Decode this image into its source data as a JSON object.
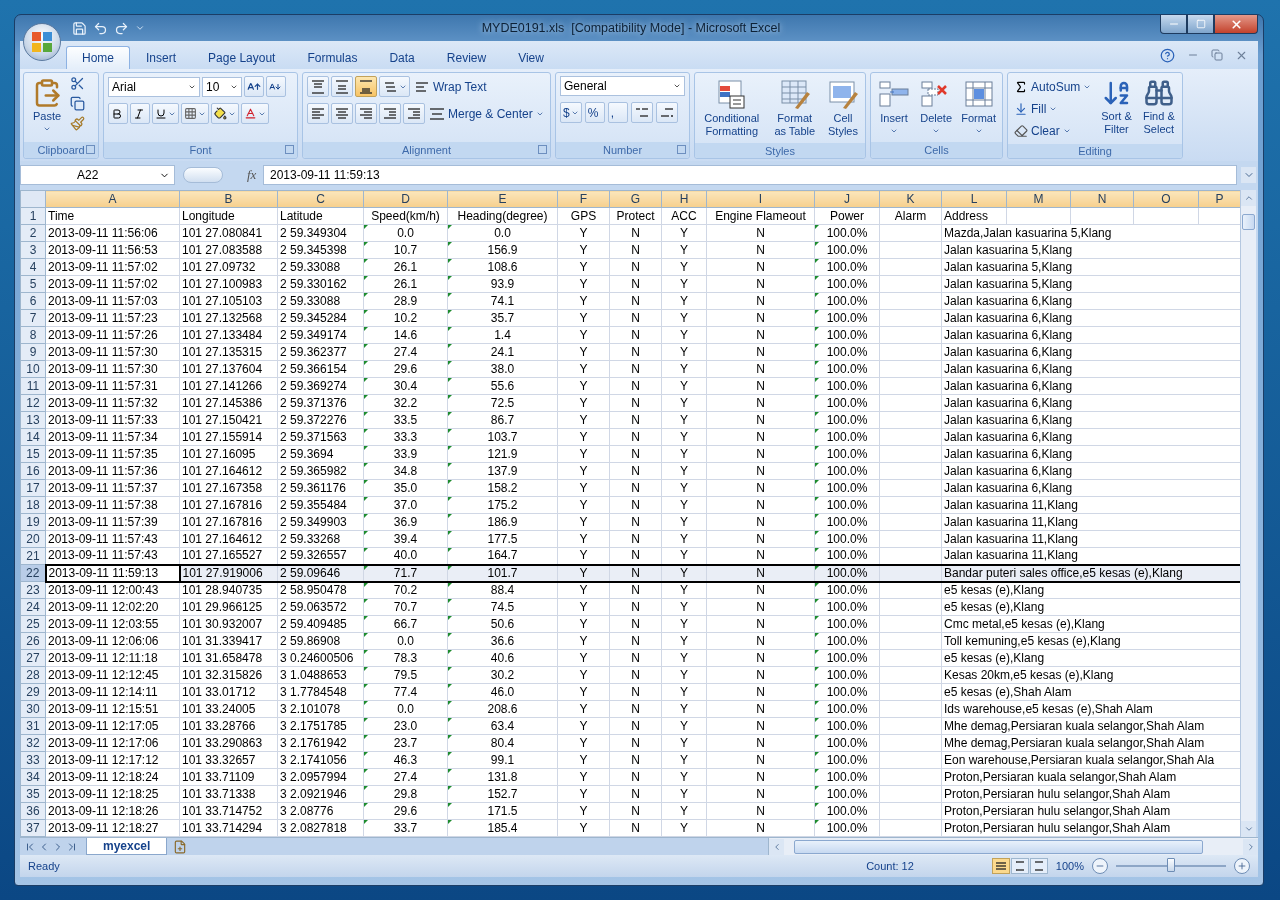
{
  "window": {
    "title": "MYDE0191.xls  [Compatibility Mode] - Microsoft Excel"
  },
  "tabs": [
    {
      "label": "Home",
      "selected": true
    },
    {
      "label": "Insert",
      "selected": false
    },
    {
      "label": "Page Layout",
      "selected": false
    },
    {
      "label": "Formulas",
      "selected": false
    },
    {
      "label": "Data",
      "selected": false
    },
    {
      "label": "Review",
      "selected": false
    },
    {
      "label": "View",
      "selected": false
    }
  ],
  "ribbon": {
    "clipboard": {
      "label": "Clipboard",
      "paste": "Paste"
    },
    "font": {
      "label": "Font",
      "font_name": "Arial",
      "font_size": "10"
    },
    "alignment": {
      "label": "Alignment",
      "vertical_align": [
        {
          "selected": false
        },
        {
          "selected": false
        },
        {
          "selected": true
        }
      ],
      "wrap_text": "Wrap Text",
      "merge_center": "Merge & Center"
    },
    "number": {
      "label": "Number",
      "format": "General",
      "currency": "$",
      "percent": "%",
      "comma": ","
    },
    "styles": {
      "label": "Styles",
      "buttons": [
        "Conditional Formatting",
        "Format as Table",
        "Cell Styles"
      ]
    },
    "cells": {
      "label": "Cells",
      "buttons": [
        "Insert",
        "Delete",
        "Format"
      ]
    },
    "editing": {
      "label": "Editing",
      "small": [
        "AutoSum",
        "Fill",
        "Clear"
      ],
      "large": [
        "Sort & Filter",
        "Find & Select"
      ]
    }
  },
  "formula_bar": {
    "name_box": "A22",
    "function_label": "fx",
    "value": "2013-09-11 11:59:13"
  },
  "columns": [
    {
      "letter": "A",
      "flagged": false
    },
    {
      "letter": "B",
      "flagged": false
    },
    {
      "letter": "C",
      "flagged": false
    },
    {
      "letter": "D",
      "flagged": true
    },
    {
      "letter": "E",
      "flagged": true
    },
    {
      "letter": "F",
      "flagged": false
    },
    {
      "letter": "G",
      "flagged": false
    },
    {
      "letter": "H",
      "flagged": false
    },
    {
      "letter": "I",
      "flagged": false
    },
    {
      "letter": "J",
      "flagged": true
    },
    {
      "letter": "K",
      "flagged": false
    },
    {
      "letter": "L",
      "flagged": false
    },
    {
      "letter": "M"
    },
    {
      "letter": "N"
    },
    {
      "letter": "O"
    },
    {
      "letter": "P"
    }
  ],
  "header_row": {
    "number": "1",
    "cells": [
      "Time",
      "Longitude",
      "Latitude",
      "Speed(km/h)",
      "Heading(degree)",
      "GPS",
      "Protect",
      "ACC",
      "Engine Flameout",
      "Power",
      "Alarm",
      "Address"
    ]
  },
  "rows": [
    {
      "number": "2",
      "selected": false,
      "cells": [
        "2013-09-11 11:56:06",
        "101 27.080841",
        "2 59.349304",
        "0.0",
        "0.0",
        "Y",
        "N",
        "Y",
        "N",
        "100.0%",
        "Mazda,Jalan kasuarina 5,Klang"
      ]
    },
    {
      "number": "3",
      "selected": false,
      "cells": [
        "2013-09-11 11:56:53",
        "101 27.083588",
        "2 59.345398",
        "10.7",
        "156.9",
        "Y",
        "N",
        "Y",
        "N",
        "100.0%",
        "Jalan kasuarina 5,Klang"
      ]
    },
    {
      "number": "4",
      "selected": false,
      "cells": [
        "2013-09-11 11:57:02",
        "101 27.09732",
        "2 59.33088",
        "26.1",
        "108.6",
        "Y",
        "N",
        "Y",
        "N",
        "100.0%",
        "Jalan kasuarina 5,Klang"
      ]
    },
    {
      "number": "5",
      "selected": false,
      "cells": [
        "2013-09-11 11:57:02",
        "101 27.100983",
        "2 59.330162",
        "26.1",
        "93.9",
        "Y",
        "N",
        "Y",
        "N",
        "100.0%",
        "Jalan kasuarina 5,Klang"
      ]
    },
    {
      "number": "6",
      "selected": false,
      "cells": [
        "2013-09-11 11:57:03",
        "101 27.105103",
        "2 59.33088",
        "28.9",
        "74.1",
        "Y",
        "N",
        "Y",
        "N",
        "100.0%",
        "Jalan kasuarina 6,Klang"
      ]
    },
    {
      "number": "7",
      "selected": false,
      "cells": [
        "2013-09-11 11:57:23",
        "101 27.132568",
        "2 59.345284",
        "10.2",
        "35.7",
        "Y",
        "N",
        "Y",
        "N",
        "100.0%",
        "Jalan kasuarina 6,Klang"
      ]
    },
    {
      "number": "8",
      "selected": false,
      "cells": [
        "2013-09-11 11:57:26",
        "101 27.133484",
        "2 59.349174",
        "14.6",
        "1.4",
        "Y",
        "N",
        "Y",
        "N",
        "100.0%",
        "Jalan kasuarina 6,Klang"
      ]
    },
    {
      "number": "9",
      "selected": false,
      "cells": [
        "2013-09-11 11:57:30",
        "101 27.135315",
        "2 59.362377",
        "27.4",
        "24.1",
        "Y",
        "N",
        "Y",
        "N",
        "100.0%",
        "Jalan kasuarina 6,Klang"
      ]
    },
    {
      "number": "10",
      "selected": false,
      "cells": [
        "2013-09-11 11:57:30",
        "101 27.137604",
        "2 59.366154",
        "29.6",
        "38.0",
        "Y",
        "N",
        "Y",
        "N",
        "100.0%",
        "Jalan kasuarina 6,Klang"
      ]
    },
    {
      "number": "11",
      "selected": false,
      "cells": [
        "2013-09-11 11:57:31",
        "101 27.141266",
        "2 59.369274",
        "30.4",
        "55.6",
        "Y",
        "N",
        "Y",
        "N",
        "100.0%",
        "Jalan kasuarina 6,Klang"
      ]
    },
    {
      "number": "12",
      "selected": false,
      "cells": [
        "2013-09-11 11:57:32",
        "101 27.145386",
        "2 59.371376",
        "32.2",
        "72.5",
        "Y",
        "N",
        "Y",
        "N",
        "100.0%",
        "Jalan kasuarina 6,Klang"
      ]
    },
    {
      "number": "13",
      "selected": false,
      "cells": [
        "2013-09-11 11:57:33",
        "101 27.150421",
        "2 59.372276",
        "33.5",
        "86.7",
        "Y",
        "N",
        "Y",
        "N",
        "100.0%",
        "Jalan kasuarina 6,Klang"
      ]
    },
    {
      "number": "14",
      "selected": false,
      "cells": [
        "2013-09-11 11:57:34",
        "101 27.155914",
        "2 59.371563",
        "33.3",
        "103.7",
        "Y",
        "N",
        "Y",
        "N",
        "100.0%",
        "Jalan kasuarina 6,Klang"
      ]
    },
    {
      "number": "15",
      "selected": false,
      "cells": [
        "2013-09-11 11:57:35",
        "101 27.16095",
        "2 59.3694",
        "33.9",
        "121.9",
        "Y",
        "N",
        "Y",
        "N",
        "100.0%",
        "Jalan kasuarina 6,Klang"
      ]
    },
    {
      "number": "16",
      "selected": false,
      "cells": [
        "2013-09-11 11:57:36",
        "101 27.164612",
        "2 59.365982",
        "34.8",
        "137.9",
        "Y",
        "N",
        "Y",
        "N",
        "100.0%",
        "Jalan kasuarina 6,Klang"
      ]
    },
    {
      "number": "17",
      "selected": false,
      "cells": [
        "2013-09-11 11:57:37",
        "101 27.167358",
        "2 59.361176",
        "35.0",
        "158.2",
        "Y",
        "N",
        "Y",
        "N",
        "100.0%",
        "Jalan kasuarina 6,Klang"
      ]
    },
    {
      "number": "18",
      "selected": false,
      "cells": [
        "2013-09-11 11:57:38",
        "101 27.167816",
        "2 59.355484",
        "37.0",
        "175.2",
        "Y",
        "N",
        "Y",
        "N",
        "100.0%",
        "Jalan kasuarina 11,Klang"
      ]
    },
    {
      "number": "19",
      "selected": false,
      "cells": [
        "2013-09-11 11:57:39",
        "101 27.167816",
        "2 59.349903",
        "36.9",
        "186.9",
        "Y",
        "N",
        "Y",
        "N",
        "100.0%",
        "Jalan kasuarina 11,Klang"
      ]
    },
    {
      "number": "20",
      "selected": false,
      "cells": [
        "2013-09-11 11:57:43",
        "101 27.164612",
        "2 59.33268",
        "39.4",
        "177.5",
        "Y",
        "N",
        "Y",
        "N",
        "100.0%",
        "Jalan kasuarina 11,Klang"
      ]
    },
    {
      "number": "21",
      "selected": false,
      "cells": [
        "2013-09-11 11:57:43",
        "101 27.165527",
        "2 59.326557",
        "40.0",
        "164.7",
        "Y",
        "N",
        "Y",
        "N",
        "100.0%",
        "Jalan kasuarina 11,Klang"
      ]
    },
    {
      "number": "22",
      "selected": true,
      "cells": [
        "2013-09-11 11:59:13",
        "101 27.919006",
        "2 59.09646",
        "71.7",
        "101.7",
        "Y",
        "N",
        "Y",
        "N",
        "100.0%",
        "Bandar puteri sales office,e5 kesas (e),Klang"
      ]
    },
    {
      "number": "23",
      "selected": false,
      "cells": [
        "2013-09-11 12:00:43",
        "101 28.940735",
        "2 58.950478",
        "70.2",
        "88.4",
        "Y",
        "N",
        "Y",
        "N",
        "100.0%",
        "e5 kesas (e),Klang"
      ]
    },
    {
      "number": "24",
      "selected": false,
      "cells": [
        "2013-09-11 12:02:20",
        "101 29.966125",
        "2 59.063572",
        "70.7",
        "74.5",
        "Y",
        "N",
        "Y",
        "N",
        "100.0%",
        "e5 kesas (e),Klang"
      ]
    },
    {
      "number": "25",
      "selected": false,
      "cells": [
        "2013-09-11 12:03:55",
        "101 30.932007",
        "2 59.409485",
        "66.7",
        "50.6",
        "Y",
        "N",
        "Y",
        "N",
        "100.0%",
        "Cmc metal,e5 kesas (e),Klang"
      ]
    },
    {
      "number": "26",
      "selected": false,
      "cells": [
        "2013-09-11 12:06:06",
        "101 31.339417",
        "2 59.86908",
        "0.0",
        "36.6",
        "Y",
        "N",
        "Y",
        "N",
        "100.0%",
        "Toll kemuning,e5 kesas (e),Klang"
      ]
    },
    {
      "number": "27",
      "selected": false,
      "cells": [
        "2013-09-11 12:11:18",
        "101 31.658478",
        "3 0.24600506",
        "78.3",
        "40.6",
        "Y",
        "N",
        "Y",
        "N",
        "100.0%",
        "e5 kesas (e),Klang"
      ]
    },
    {
      "number": "28",
      "selected": false,
      "cells": [
        "2013-09-11 12:12:45",
        "101 32.315826",
        "3 1.0488653",
        "79.5",
        "30.2",
        "Y",
        "N",
        "Y",
        "N",
        "100.0%",
        "Kesas 20km,e5 kesas (e),Klang"
      ]
    },
    {
      "number": "29",
      "selected": false,
      "cells": [
        "2013-09-11 12:14:11",
        "101 33.01712",
        "3 1.7784548",
        "77.4",
        "46.0",
        "Y",
        "N",
        "Y",
        "N",
        "100.0%",
        "e5 kesas (e),Shah Alam"
      ]
    },
    {
      "number": "30",
      "selected": false,
      "cells": [
        "2013-09-11 12:15:51",
        "101 33.24005",
        "3 2.101078",
        "0.0",
        "208.6",
        "Y",
        "N",
        "Y",
        "N",
        "100.0%",
        "Ids warehouse,e5 kesas (e),Shah Alam"
      ]
    },
    {
      "number": "31",
      "selected": false,
      "cells": [
        "2013-09-11 12:17:05",
        "101 33.28766",
        "3 2.1751785",
        "23.0",
        "63.4",
        "Y",
        "N",
        "Y",
        "N",
        "100.0%",
        "Mhe demag,Persiaran kuala selangor,Shah Alam"
      ]
    },
    {
      "number": "32",
      "selected": false,
      "cells": [
        "2013-09-11 12:17:06",
        "101 33.290863",
        "3 2.1761942",
        "23.7",
        "80.4",
        "Y",
        "N",
        "Y",
        "N",
        "100.0%",
        "Mhe demag,Persiaran kuala selangor,Shah Alam"
      ]
    },
    {
      "number": "33",
      "selected": false,
      "cells": [
        "2013-09-11 12:17:12",
        "101 33.32657",
        "3 2.1741056",
        "46.3",
        "99.1",
        "Y",
        "N",
        "Y",
        "N",
        "100.0%",
        "Eon warehouse,Persiaran kuala selangor,Shah Ala"
      ]
    },
    {
      "number": "34",
      "selected": false,
      "cells": [
        "2013-09-11 12:18:24",
        "101 33.71109",
        "3 2.0957994",
        "27.4",
        "131.8",
        "Y",
        "N",
        "Y",
        "N",
        "100.0%",
        "Proton,Persiaran kuala selangor,Shah Alam"
      ]
    },
    {
      "number": "35",
      "selected": false,
      "cells": [
        "2013-09-11 12:18:25",
        "101 33.71338",
        "3 2.0921946",
        "29.8",
        "152.7",
        "Y",
        "N",
        "Y",
        "N",
        "100.0%",
        "Proton,Persiaran hulu selangor,Shah Alam"
      ]
    },
    {
      "number": "36",
      "selected": false,
      "cells": [
        "2013-09-11 12:18:26",
        "101 33.714752",
        "3 2.08776",
        "29.6",
        "171.5",
        "Y",
        "N",
        "Y",
        "N",
        "100.0%",
        "Proton,Persiaran hulu selangor,Shah Alam"
      ]
    },
    {
      "number": "37",
      "selected": false,
      "cells": [
        "2013-09-11 12:18:27",
        "101 33.714294",
        "3 2.0827818",
        "33.7",
        "185.4",
        "Y",
        "N",
        "Y",
        "N",
        "100.0%",
        "Proton,Persiaran hulu selangor,Shah Alam"
      ]
    }
  ],
  "sheet_tabs": [
    {
      "label": "myexcel",
      "selected": true
    }
  ],
  "status_bar": {
    "status": "Ready",
    "count": "Count: 12",
    "views": [
      {
        "selected": true
      },
      {
        "selected": false
      },
      {
        "selected": false
      }
    ],
    "zoom": "100%",
    "zoom_slider": {
      "level": 0.5
    }
  }
}
